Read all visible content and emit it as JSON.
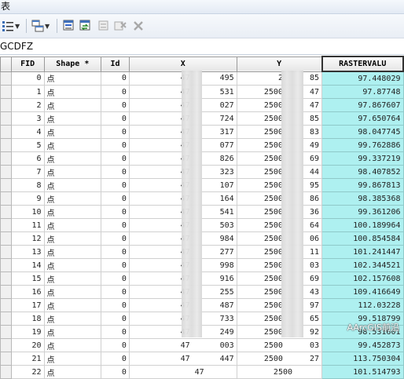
{
  "window": {
    "title": "表"
  },
  "tab": {
    "label": "GCDFZ"
  },
  "table": {
    "columns": [
      "FID",
      "Shape *",
      "Id",
      "X",
      "Y",
      "RASTERVALU"
    ],
    "rows": [
      {
        "fid": "0",
        "shape": "点",
        "id": "0",
        "x_start": "47",
        "x_end": "495",
        "y_start": "2",
        "y_end": "85",
        "rv": "97.448029"
      },
      {
        "fid": "1",
        "shape": "点",
        "id": "0",
        "x_start": "47",
        "x_end": "531",
        "y_start": "2500",
        "y_end": "47",
        "rv": "97.87748"
      },
      {
        "fid": "2",
        "shape": "点",
        "id": "0",
        "x_start": "47",
        "x_end": "027",
        "y_start": "2500",
        "y_end": "47",
        "rv": "97.867607"
      },
      {
        "fid": "3",
        "shape": "点",
        "id": "0",
        "x_start": "47",
        "x_end": "724",
        "y_start": "2500",
        "y_end": "85",
        "rv": "97.650764"
      },
      {
        "fid": "4",
        "shape": "点",
        "id": "0",
        "x_start": "47",
        "x_end": "317",
        "y_start": "2500",
        "y_end": "83",
        "rv": "98.047745"
      },
      {
        "fid": "5",
        "shape": "点",
        "id": "0",
        "x_start": "47",
        "x_end": "077",
        "y_start": "2500",
        "y_end": "49",
        "rv": "99.762886"
      },
      {
        "fid": "6",
        "shape": "点",
        "id": "0",
        "x_start": "47",
        "x_end": "826",
        "y_start": "2500",
        "y_end": "69",
        "rv": "99.337219"
      },
      {
        "fid": "7",
        "shape": "点",
        "id": "0",
        "x_start": "47",
        "x_end": "323",
        "y_start": "2500",
        "y_end": "44",
        "rv": "98.407852"
      },
      {
        "fid": "8",
        "shape": "点",
        "id": "0",
        "x_start": "47",
        "x_end": "107",
        "y_start": "2500",
        "y_end": "95",
        "rv": "99.867813"
      },
      {
        "fid": "9",
        "shape": "点",
        "id": "0",
        "x_start": "47",
        "x_end": "164",
        "y_start": "2500",
        "y_end": "86",
        "rv": "98.385368"
      },
      {
        "fid": "10",
        "shape": "点",
        "id": "0",
        "x_start": "47",
        "x_end": "541",
        "y_start": "2500",
        "y_end": "36",
        "rv": "99.361206"
      },
      {
        "fid": "11",
        "shape": "点",
        "id": "0",
        "x_start": "47",
        "x_end": "503",
        "y_start": "2500",
        "y_end": "64",
        "rv": "100.189964"
      },
      {
        "fid": "12",
        "shape": "点",
        "id": "0",
        "x_start": "47",
        "x_end": "984",
        "y_start": "2500",
        "y_end": "06",
        "rv": "100.854584"
      },
      {
        "fid": "13",
        "shape": "点",
        "id": "0",
        "x_start": "47",
        "x_end": "277",
        "y_start": "2500",
        "y_end": "11",
        "rv": "101.241447"
      },
      {
        "fid": "14",
        "shape": "点",
        "id": "0",
        "x_start": "47",
        "x_end": "998",
        "y_start": "2500",
        "y_end": "03",
        "rv": "102.344521"
      },
      {
        "fid": "15",
        "shape": "点",
        "id": "0",
        "x_start": "47",
        "x_end": "916",
        "y_start": "2500",
        "y_end": "69",
        "rv": "102.157608"
      },
      {
        "fid": "16",
        "shape": "点",
        "id": "0",
        "x_start": "47",
        "x_end": "255",
        "y_start": "2500",
        "y_end": "43",
        "rv": "109.416649"
      },
      {
        "fid": "17",
        "shape": "点",
        "id": "0",
        "x_start": "47",
        "x_end": "487",
        "y_start": "2500",
        "y_end": "97",
        "rv": "112.03228"
      },
      {
        "fid": "18",
        "shape": "点",
        "id": "0",
        "x_start": "47",
        "x_end": "733",
        "y_start": "2500",
        "y_end": "65",
        "rv": "99.518799"
      },
      {
        "fid": "19",
        "shape": "点",
        "id": "0",
        "x_start": "47",
        "x_end": "249",
        "y_start": "2500",
        "y_end": "92",
        "rv": "98.531601"
      },
      {
        "fid": "20",
        "shape": "点",
        "id": "0",
        "x_start": "47",
        "x_end": "003",
        "y_start": "2500",
        "y_end": "03",
        "rv": "99.452873"
      },
      {
        "fid": "21",
        "shape": "点",
        "id": "0",
        "x_start": "47",
        "x_end": "447",
        "y_start": "2500",
        "y_end": "27",
        "rv": "113.750304"
      },
      {
        "fid": "22",
        "shape": "点",
        "id": "0",
        "x_start": "47",
        "x_end": "",
        "y_start": "2500",
        "y_end": "",
        "rv": "101.514793"
      }
    ]
  },
  "watermark": {
    "text": "AArcGIS前沿"
  }
}
